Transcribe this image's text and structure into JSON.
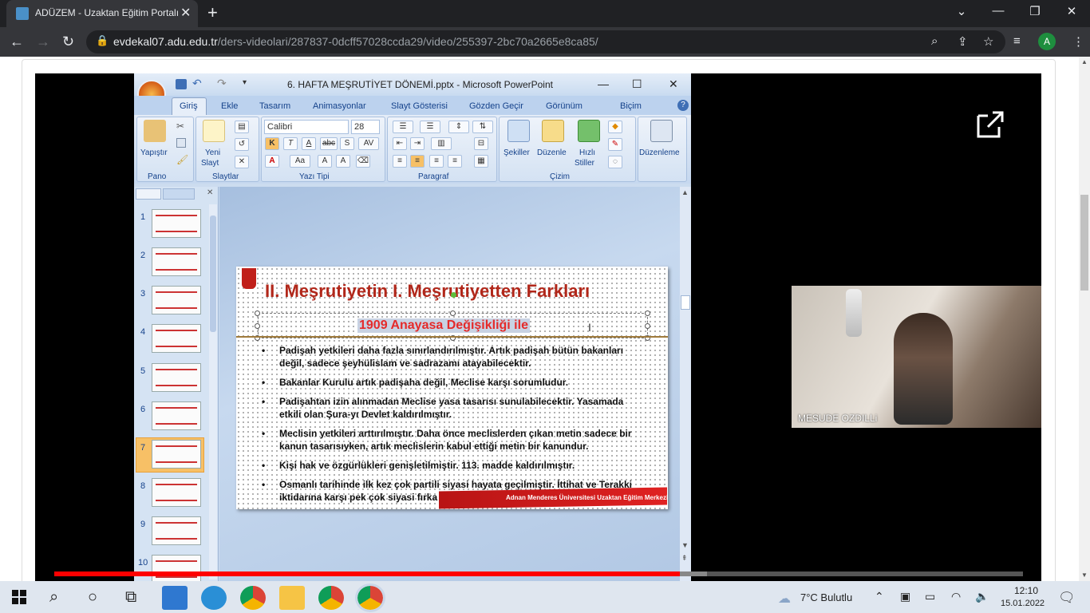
{
  "browser": {
    "tab_title": "ADÜZEM - Uzaktan Eğitim Portalı",
    "tab_close": "✕",
    "new_tab": "+",
    "url_host": "evdekal07.adu.edu.tr",
    "url_path": "/ders-videolari/287837-0dcff57028ccda29/video/255397-2bc70a2665e8ca85/",
    "profile_initial": "A"
  },
  "powerpoint": {
    "window_title": "6. HAFTA MEŞRUTİYET DÖNEMİ.pptx - Microsoft PowerPoint",
    "tabs": [
      "Giriş",
      "Ekle",
      "Tasarım",
      "Animasyonlar",
      "Slayt Gösterisi",
      "Gözden Geçir",
      "Görünüm",
      "Biçim"
    ],
    "groups": {
      "pano": "Pano",
      "slaytlar": "Slaytlar",
      "yazi_tipi": "Yazı Tipi",
      "paragraf": "Paragraf",
      "cizim": "Çizim"
    },
    "buttons": {
      "yapistir": "Yapıştır",
      "yeni_slayt_1": "Yeni",
      "yeni_slayt_2": "Slayt",
      "sekiller": "Şekiller",
      "duzenle": "Düzenle",
      "hizli_1": "Hızlı",
      "hizli_2": "Stiller",
      "duzenleme": "Düzenleme"
    },
    "font_name": "Calibri",
    "font_size": "28",
    "thumbnail_numbers": [
      "1",
      "2",
      "3",
      "4",
      "5",
      "6",
      "7",
      "8",
      "9",
      "10"
    ],
    "selected_slide": "7"
  },
  "slide": {
    "title": "II. Meşrutiyetin I. Meşrutiyetten Farkları",
    "subtitle": "1909 Anayasa Değişikliği ile",
    "bullets": [
      "Padişah yetkileri daha fazla sınırlandırılmıştır. Artık padişah bütün bakanları değil, sadece şeyhülislam ve sadrazamı atayabilecektir.",
      "Bakanlar Kurulu artık padişaha değil, Meclise karşı sorumludur.",
      "Padişahtan izin alınmadan Meclise yasa tasarısı sunulabilecektir. Yasamada etkili olan Şura-yı Devlet kaldırılmıştır.",
      "Meclisin yetkileri arttırılmıştır. Daha önce meclislerden çıkan metin sadece bir kanun tasarısıyken, artık meclislerin kabul ettiği metin bir kanundur.",
      "Kişi hak ve özgürlükleri genişletilmiştir. 113. madde kaldırılmıştır.",
      "Osmanlı tarihinde ilk kez çok partili siyasi hayata geçilmiştir. İttihat ve Terakki iktidarına karşı pek çok siyasi fırka kurulmuştur."
    ],
    "footer": "Adnan Menderes Üniversitesi Uzaktan Eğitim Merkezi"
  },
  "presenter": {
    "name": "MESUDE OZDILLi"
  },
  "player": {
    "progress_fraction": 0.646
  },
  "taskbar": {
    "weather": "7°C  Bulutlu",
    "time": "12:10",
    "date": "15.01.2022"
  },
  "colors": {
    "slide_title": "#b1271a",
    "subtitle": "#e52a2a",
    "progress": "#ff0000"
  }
}
